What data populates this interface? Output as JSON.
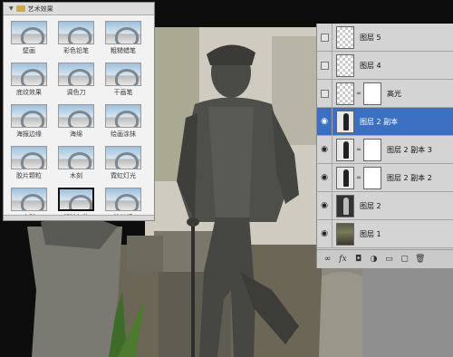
{
  "gallery": {
    "header_label": "艺术效果",
    "filters": [
      {
        "label": "壁画"
      },
      {
        "label": "彩色铅笔"
      },
      {
        "label": "粗糙蜡笔"
      },
      {
        "label": "底纹效果"
      },
      {
        "label": "调色刀"
      },
      {
        "label": "干画笔"
      },
      {
        "label": "海报边缘"
      },
      {
        "label": "海绵"
      },
      {
        "label": "绘画涂抹"
      },
      {
        "label": "胶片颗粒"
      },
      {
        "label": "木刻"
      },
      {
        "label": "霓虹灯光"
      },
      {
        "label": "水彩"
      },
      {
        "label": "塑料包装",
        "selected": true
      },
      {
        "label": "涂抹棒"
      }
    ]
  },
  "layers": {
    "rows": [
      {
        "name": "图层 5",
        "visible": false,
        "thumb": "transparent"
      },
      {
        "name": "图层 4",
        "visible": false,
        "thumb": "transparent"
      },
      {
        "name": "高光",
        "visible": false,
        "thumb": "transparent",
        "mask": true
      },
      {
        "name": "图层 2 副本",
        "visible": true,
        "thumb": "statue",
        "selected": true
      },
      {
        "name": "图层 2 副本 3",
        "visible": true,
        "thumb": "statue",
        "mask": true
      },
      {
        "name": "图层 2 副本 2",
        "visible": true,
        "thumb": "statue",
        "mask": true
      },
      {
        "name": "图层 2",
        "visible": true,
        "thumb": "statue-dark"
      },
      {
        "name": "图层 1",
        "visible": true,
        "thumb": "photo"
      }
    ],
    "bottom_icons": [
      "link-icon",
      "fx-icon",
      "mask-icon",
      "adjustment-icon",
      "group-icon",
      "new-layer-icon",
      "trash-icon"
    ]
  }
}
